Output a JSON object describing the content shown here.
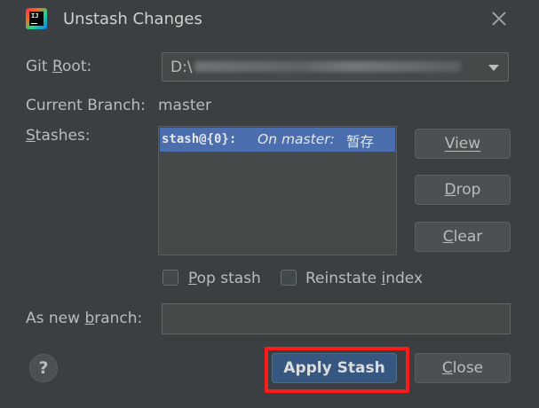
{
  "window": {
    "title": "Unstash Changes",
    "app_icon": "intellij-idea-icon"
  },
  "git_root": {
    "label_prefix": "Git ",
    "label_mnemonic": "R",
    "label_suffix": "oot:",
    "value": "D:\\"
  },
  "current_branch": {
    "label": "Current Branch:",
    "value": "master"
  },
  "stashes": {
    "label_mnemonic": "S",
    "label_rest": "tashes:",
    "items": [
      {
        "ref": "stash@{0}:",
        "message": "On master:",
        "note": "暂存",
        "selected": true
      }
    ]
  },
  "buttons": {
    "view": {
      "mnemonic": "V",
      "rest": "iew"
    },
    "drop": {
      "mnemonic": "D",
      "rest": "rop"
    },
    "clear": {
      "mnemonic": "C",
      "rest": "lear"
    },
    "apply": "Apply Stash",
    "close": {
      "mnemonic": "C",
      "rest": "lose"
    },
    "help": "?"
  },
  "options": {
    "pop": {
      "mnemonic": "P",
      "rest": "op stash",
      "checked": false
    },
    "reinstate": {
      "before": "Reinstate ",
      "mnemonic": "i",
      "rest": "ndex",
      "checked": false
    }
  },
  "new_branch": {
    "label_before": "As new ",
    "label_mnemonic": "b",
    "label_rest": "ranch:",
    "value": ""
  },
  "colors": {
    "background": "#3c3f41",
    "selection": "#4b6eaf",
    "default_button": "#365880",
    "highlight_box": "#ff1a1a"
  }
}
